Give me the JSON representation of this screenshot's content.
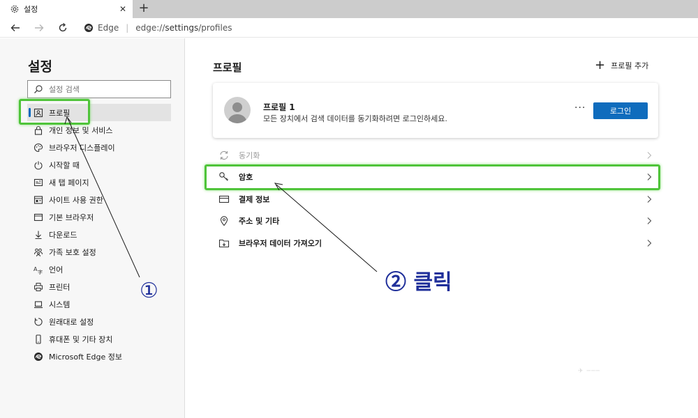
{
  "browser": {
    "tab_title": "설정",
    "new_tab": "+",
    "address_brand": "Edge",
    "address_separator": "|",
    "address_prefix": "edge://",
    "address_host": "settings",
    "address_path": "/profiles"
  },
  "sidebar": {
    "title": "설정",
    "search_placeholder": "설정 검색",
    "items": [
      {
        "label": "프로필",
        "icon": "profile-icon",
        "active": true
      },
      {
        "label": "개인 정보 및 서비스",
        "icon": "lock-icon"
      },
      {
        "label": "브라우저 디스플레이",
        "icon": "palette-icon"
      },
      {
        "label": "시작할 때",
        "icon": "power-icon"
      },
      {
        "label": "새 탭 페이지",
        "icon": "new-tab-page-icon"
      },
      {
        "label": "사이트 사용 권한",
        "icon": "site-permissions-icon"
      },
      {
        "label": "기본 브라우저",
        "icon": "default-browser-icon"
      },
      {
        "label": "다운로드",
        "icon": "download-icon"
      },
      {
        "label": "가족 보호 설정",
        "icon": "family-icon"
      },
      {
        "label": "언어",
        "icon": "language-icon"
      },
      {
        "label": "프린터",
        "icon": "printer-icon"
      },
      {
        "label": "시스템",
        "icon": "laptop-icon"
      },
      {
        "label": "원래대로 설정",
        "icon": "reset-icon"
      },
      {
        "label": "휴대폰 및 기타 장치",
        "icon": "phone-icon"
      },
      {
        "label": "Microsoft Edge 정보",
        "icon": "edge-logo-icon"
      }
    ]
  },
  "main": {
    "title": "프로필",
    "add_profile_label": "프로필 추가",
    "profile": {
      "name": "프로필 1",
      "description": "모든 장치에서 검색 데이터를 동기화하려면 로그인하세요.",
      "more": "···",
      "login_label": "로그인"
    },
    "rows": [
      {
        "label": "동기화",
        "icon": "sync-icon",
        "disabled": true
      },
      {
        "label": "암호",
        "icon": "key-icon"
      },
      {
        "label": "결제 정보",
        "icon": "card-icon"
      },
      {
        "label": "주소 및 기타",
        "icon": "location-icon"
      },
      {
        "label": "브라우저 데이터 가져오기",
        "icon": "import-icon"
      }
    ]
  },
  "annotations": {
    "step1": "①",
    "step2": "② 클릭",
    "highlight_color": "#4fc43a",
    "text_color": "#1f2f9a"
  },
  "colors": {
    "accent": "#0f6cbd",
    "sidebar_bg": "#f7f7f7"
  }
}
